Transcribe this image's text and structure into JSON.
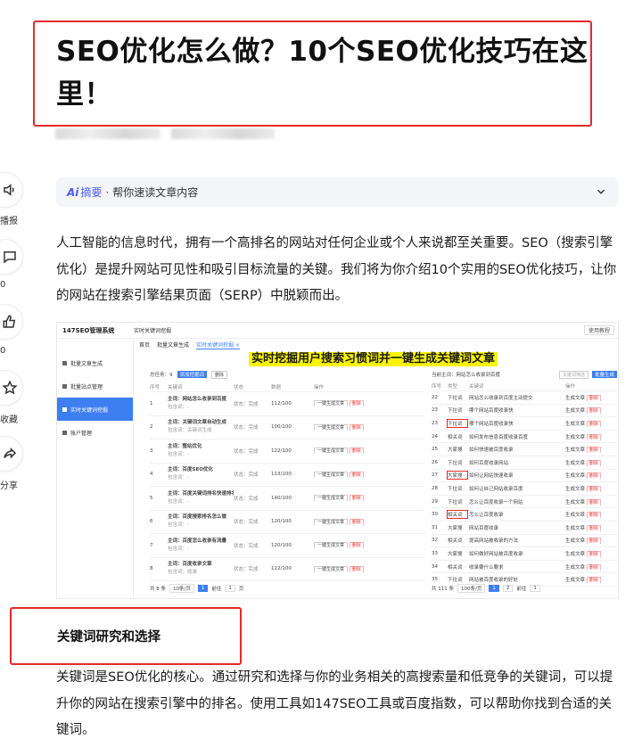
{
  "article": {
    "title": "SEO优化怎么做？10个SEO优化技巧在这里！",
    "summary": {
      "logo": "Ai",
      "label": "摘要",
      "dot": "·",
      "text": "帮你速读文章内容"
    },
    "intro": "人工智能的信息时代，拥有一个高排名的网站对任何企业或个人来说都至关重要。SEO（搜索引擎优化）是提升网站可见性和吸引目标流量的关键。我们将为你介绍10个实用的SEO优化技巧，让你的网站在搜索引擎结果页面（SERP）中脱颖而出。",
    "section_title": "关键词研究和选择",
    "section_body": "关键词是SEO优化的核心。通过研究和选择与你的业务相关的高搜索量和低竞争的关键词，可以提升你的网站在搜索引擎中的排名。使用工具如147SEO工具或百度指数，可以帮助你找到合适的关键词。"
  },
  "side_toolbar": [
    {
      "icon": "speaker-icon",
      "label": "播报"
    },
    {
      "icon": "comment-icon",
      "label": "0"
    },
    {
      "icon": "thumbs-up-icon",
      "label": "0"
    },
    {
      "icon": "star-icon",
      "label": "收藏"
    },
    {
      "icon": "share-icon",
      "label": "分享"
    }
  ],
  "screenshot": {
    "app_name": "147SEO管理系统",
    "breadcrumb": "实时关键词挖掘",
    "top_right": "使用教程",
    "nav": [
      "批量文章生成",
      "批量站点管理",
      "实时关键词挖掘",
      "账户管理"
    ],
    "tabs": [
      "首页",
      "批量文章生成",
      "实时关键词挖掘 ×"
    ],
    "banner": "实时挖掘用户搜索习惯词并一键生成关键词文章",
    "left_toolbar": {
      "total": "总任务：9",
      "add": "添加挖掘词",
      "del": "删除"
    },
    "left_headers": [
      "序号",
      "关键词",
      "状态",
      "数据",
      "操作"
    ],
    "left_rows": [
      {
        "n": "1",
        "kw": "主词：网站怎么收录到百度",
        "sub": "包含词：-",
        "st": "状态：完成",
        "data": "112/100"
      },
      {
        "n": "2",
        "kw": "主词：关键词文章自动生成",
        "sub": "包含词：关键词生成",
        "st": "状态：完成",
        "data": "100/100"
      },
      {
        "n": "3",
        "kw": "主词：整站优化",
        "sub": "包含词：-",
        "st": "状态：完成",
        "data": "122/100"
      },
      {
        "n": "4",
        "kw": "主词：百度SEO优化",
        "sub": "包含词：-",
        "st": "状态：完成",
        "data": "113/100"
      },
      {
        "n": "5",
        "kw": "主词：百度关键词排名快速排名",
        "sub": "包含词：-",
        "st": "状态：完成",
        "data": "140/100"
      },
      {
        "n": "6",
        "kw": "主词：百度搜索排名怎么做",
        "sub": "包含词：-",
        "st": "状态：完成",
        "data": "120/100"
      },
      {
        "n": "7",
        "kw": "主词：百度怎么收录有流量",
        "sub": "包含词：-",
        "st": "状态：完成",
        "data": "120/100"
      },
      {
        "n": "8",
        "kw": "主词：百度收录文章",
        "sub": "包含词：收录",
        "st": "状态：完成",
        "data": "122/100"
      }
    ],
    "row_action": "一键生成文章",
    "row_delete": "删除",
    "left_pager": {
      "total": "共 8 条",
      "size": "10条/页",
      "page": "1",
      "goto": "前往",
      "goto_page": "1",
      "unit": "页"
    },
    "right_header": "当前主词：网站怎么收录到百度",
    "right_filter": "关键词筛选",
    "right_button": "批量生成",
    "right_headers": [
      "序号",
      "类型",
      "关键词",
      "操作"
    ],
    "right_rows": [
      {
        "n": "22",
        "t": "下拉词",
        "kw": "网站怎么收录到百度主动提交",
        "boxed": false
      },
      {
        "n": "23",
        "t": "下拉词",
        "kw": "哪个网站百度收录快",
        "boxed": false
      },
      {
        "n": "23",
        "t": "下拉词",
        "kw": "哪个网站百度收录快",
        "boxed": true
      },
      {
        "n": "24",
        "t": "相关词",
        "kw": "如何发布信息百度收录百度",
        "boxed": false
      },
      {
        "n": "25",
        "t": "大家搜",
        "kw": "如何快速被百度收录",
        "boxed": false
      },
      {
        "n": "26",
        "t": "下拉词",
        "kw": "如何百度收录网站",
        "boxed": false
      },
      {
        "n": "27",
        "t": "大家搜",
        "kw": "如何让网站快速收录",
        "boxed": true
      },
      {
        "n": "28",
        "t": "下拉词",
        "kw": "如何让自己网站收录百度",
        "boxed": false
      },
      {
        "n": "29",
        "t": "下拉词",
        "kw": "怎么让百度收录一个网站",
        "boxed": false
      },
      {
        "n": "30",
        "t": "相关词",
        "kw": "怎么让百度收录",
        "boxed": true
      },
      {
        "n": "31",
        "t": "大家搜",
        "kw": "网站百度收录",
        "boxed": false
      },
      {
        "n": "32",
        "t": "相关词",
        "kw": "提高网站被收录的方法",
        "boxed": false
      },
      {
        "n": "33",
        "t": "大家搜",
        "kw": "如何做好网站被百度收录",
        "boxed": false
      },
      {
        "n": "34",
        "t": "相关词",
        "kw": "收录要什么要求",
        "boxed": false
      },
      {
        "n": "35",
        "t": "下拉词",
        "kw": "网站被百度收录的好处",
        "boxed": false
      }
    ],
    "right_action": "生成文章",
    "right_pager": {
      "total": "共 111 条",
      "size": "100条/页",
      "pages": [
        "1",
        "2"
      ],
      "goto": "前往",
      "goto_page": "1"
    }
  }
}
